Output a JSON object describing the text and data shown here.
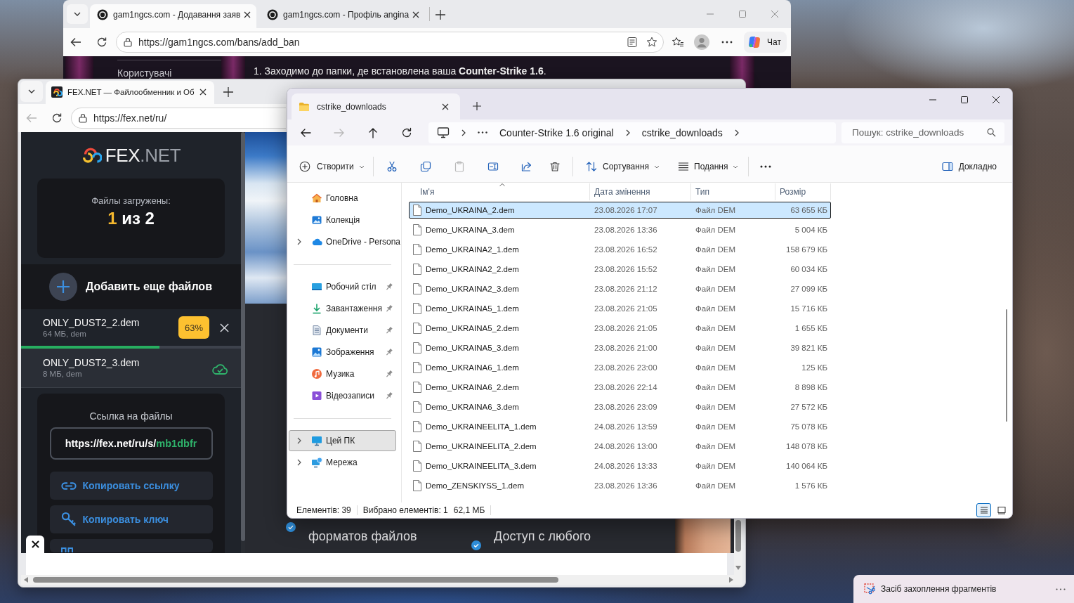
{
  "browser_back": {
    "tabs": [
      {
        "title": "gam1ngcs.com - Додавання заяв",
        "selected": true
      },
      {
        "title": "gam1ngcs.com - Профіль angina",
        "selected": false
      }
    ],
    "back_disabled": false,
    "address": "https://gam1ngcs.com/bans/add_ban",
    "chat_label": "Чат",
    "page": {
      "menu_item": "Користувачі",
      "instruction": "1. Заходимо до папки, де встановлена ваша **Counter-Strike 1.6**."
    }
  },
  "browser_front": {
    "tabs": [
      {
        "title": "FEX.NET — Файлообменник и Об",
        "selected": true
      }
    ],
    "back_disabled": true,
    "address": "https://fex.net/ru/",
    "logo": {
      "main": "FEX",
      "suffix": ".NET"
    },
    "upload_status": {
      "label": "Файлы загружены:",
      "done": "1",
      "total": "из 2"
    },
    "add_files": "Добавить еще файлов",
    "files": [
      {
        "name": "ONLY_DUST2_2.dem",
        "meta": "64 МБ, dem",
        "completed": false,
        "percent": "63%",
        "level": 0.63
      },
      {
        "name": "ONLY_DUST2_3.dem",
        "meta": "8 МБ, dem",
        "completed": true
      }
    ],
    "link_card": {
      "title": "Ссылка на файлы",
      "link_base": "https://fex.net/ru/s/",
      "link_code": "mb1dbfr",
      "actions": [
        {
          "kind": "link",
          "label": "Копировать ссылку"
        },
        {
          "kind": "key",
          "label": "Копировать ключ"
        },
        {
          "kind": "qr"
        }
      ]
    },
    "features": [
      "форматов файлов",
      "Доступ с любого"
    ]
  },
  "explorer": {
    "tab_title": "cstrike_downloads",
    "nav_buttons": [
      {
        "disabled": false
      },
      {
        "disabled": true
      },
      {
        "disabled": false
      },
      {
        "disabled": false
      }
    ],
    "breadcrumb": [
      "Counter-Strike 1.6 original",
      "cstrike_downloads"
    ],
    "search_placeholder": "Пошук: cstrike_downloads",
    "toolbar": {
      "new_label": "Створити",
      "actions": [
        {
          "disabled": false
        },
        {
          "disabled": false
        },
        {
          "disabled": true
        },
        {
          "disabled": false
        },
        {
          "disabled": false
        },
        {
          "disabled": false
        }
      ],
      "sort_label": "Сортування",
      "view_label": "Подання",
      "details_label": "Докладно"
    },
    "sidebar": [
      {
        "items": [
          {
            "label": "Головна",
            "selected": false,
            "pinned": false
          },
          {
            "label": "Колекція",
            "selected": false,
            "pinned": false
          },
          {
            "label": "OneDrive - Persona",
            "selected": false,
            "pinned": false,
            "expanded": false
          }
        ]
      },
      {
        "items": [
          {
            "label": "Робочий стіл",
            "selected": false,
            "pinned": true
          },
          {
            "label": "Завантаження",
            "selected": false,
            "pinned": true
          },
          {
            "label": "Документи",
            "selected": false,
            "pinned": true
          },
          {
            "label": "Зображення",
            "selected": false,
            "pinned": true
          },
          {
            "label": "Музика",
            "selected": false,
            "pinned": true
          },
          {
            "label": "Відеозаписи",
            "selected": false,
            "pinned": true
          }
        ]
      },
      {
        "items": [
          {
            "label": "Цей ПК",
            "selected": true,
            "pinned": false,
            "expanded": false
          },
          {
            "label": "Мережа",
            "selected": false,
            "pinned": false,
            "expanded": false
          }
        ]
      }
    ],
    "columns": [
      {
        "label": "Ім'я",
        "sorted": true
      },
      {
        "label": "Дата змінення",
        "sorted": false
      },
      {
        "label": "Тип",
        "sorted": false
      },
      {
        "label": "Розмір",
        "sorted": false
      }
    ],
    "files": [
      {
        "name": "Demo_UKRAINA_2.dem",
        "date": "23.08.2026 17:07",
        "type": "Файл DEM",
        "size": "63 655 КБ",
        "selected": true
      },
      {
        "name": "Demo_UKRAINA_3.dem",
        "date": "23.08.2026 13:36",
        "type": "Файл DEM",
        "size": "5 004 КБ",
        "selected": false
      },
      {
        "name": "Demo_UKRAINA2_1.dem",
        "date": "23.08.2026 16:52",
        "type": "Файл DEM",
        "size": "158 679 КБ",
        "selected": false
      },
      {
        "name": "Demo_UKRAINA2_2.dem",
        "date": "23.08.2026 15:52",
        "type": "Файл DEM",
        "size": "60 034 КБ",
        "selected": false
      },
      {
        "name": "Demo_UKRAINA2_3.dem",
        "date": "23.08.2026 21:12",
        "type": "Файл DEM",
        "size": "27 099 КБ",
        "selected": false
      },
      {
        "name": "Demo_UKRAINA5_1.dem",
        "date": "23.08.2026 21:05",
        "type": "Файл DEM",
        "size": "15 716 КБ",
        "selected": false
      },
      {
        "name": "Demo_UKRAINA5_2.dem",
        "date": "23.08.2026 21:05",
        "type": "Файл DEM",
        "size": "1 655 КБ",
        "selected": false
      },
      {
        "name": "Demo_UKRAINA5_3.dem",
        "date": "23.08.2026 21:00",
        "type": "Файл DEM",
        "size": "39 821 КБ",
        "selected": false
      },
      {
        "name": "Demo_UKRAINA6_1.dem",
        "date": "23.08.2026 23:00",
        "type": "Файл DEM",
        "size": "125 КБ",
        "selected": false
      },
      {
        "name": "Demo_UKRAINA6_2.dem",
        "date": "23.08.2026 22:14",
        "type": "Файл DEM",
        "size": "8 898 КБ",
        "selected": false
      },
      {
        "name": "Demo_UKRAINA6_3.dem",
        "date": "23.08.2026 23:09",
        "type": "Файл DEM",
        "size": "27 572 КБ",
        "selected": false
      },
      {
        "name": "Demo_UKRAINEELITA_1.dem",
        "date": "24.08.2026 13:59",
        "type": "Файл DEM",
        "size": "75 078 КБ",
        "selected": false
      },
      {
        "name": "Demo_UKRAINEELITA_2.dem",
        "date": "24.08.2026 13:00",
        "type": "Файл DEM",
        "size": "148 078 КБ",
        "selected": false
      },
      {
        "name": "Demo_UKRAINEELITA_3.dem",
        "date": "24.08.2026 13:33",
        "type": "Файл DEM",
        "size": "140 064 КБ",
        "selected": false
      },
      {
        "name": "Demo_ZENSKIYSS_1.dem",
        "date": "23.08.2026 13:36",
        "type": "Файл DEM",
        "size": "1 576 КБ",
        "selected": false
      }
    ],
    "status_bar": {
      "count": "Елементів: 39",
      "selection": "Вибрано елементів: 1",
      "selection_size": "62,1 МБ",
      "views": [
        {
          "selected": true
        },
        {
          "selected": false
        }
      ]
    }
  },
  "notification": {
    "title": "Засіб захоплення фрагментів"
  }
}
